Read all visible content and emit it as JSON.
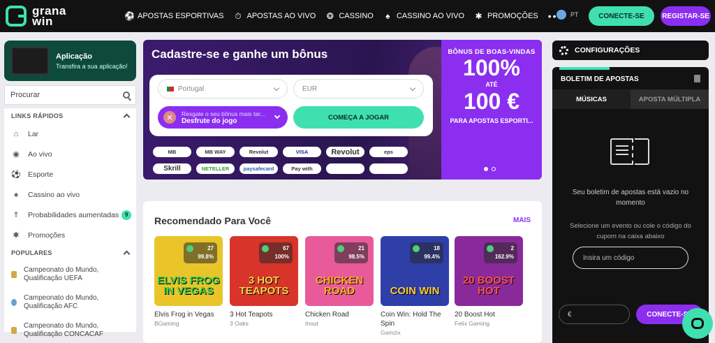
{
  "brand": {
    "line1": "grana",
    "line2": "win"
  },
  "nav": {
    "items": [
      {
        "label": "APOSTAS ESPORTIVAS",
        "icon": "soccer-ball-icon"
      },
      {
        "label": "APOSTAS AO VIVO",
        "icon": "stopwatch-icon"
      },
      {
        "label": "CASSINO",
        "icon": "roulette-icon"
      },
      {
        "label": "CASSINO AO VIVO",
        "icon": "cards-icon"
      },
      {
        "label": "PROMOÇÕES",
        "icon": "gift-icon"
      }
    ],
    "more": "•••",
    "lang": "PT",
    "login": "CONECTE-SE",
    "register": "REGISTAR-SE"
  },
  "sidebar": {
    "app": {
      "title": "Aplicação",
      "subtitle": "Transfira a sua aplicação!"
    },
    "search_placeholder": "Procurar",
    "quick_links_header": "LINKS RÁPIDOS",
    "quick_links": [
      {
        "label": "Lar",
        "icon": "home-icon"
      },
      {
        "label": "Ao vivo",
        "icon": "live-icon"
      },
      {
        "label": "Esporte",
        "icon": "soccer-ball-icon"
      },
      {
        "label": "Cassino ao vivo",
        "icon": "cards-icon"
      },
      {
        "label": "Probabilidades aumentadas",
        "icon": "boost-icon",
        "badge": "9"
      },
      {
        "label": "Promoções",
        "icon": "gift-icon"
      }
    ],
    "popular_header": "POPULARES",
    "popular": [
      {
        "label": "Campeonato do Mundo, Qualificação UEFA"
      },
      {
        "label": "Campeonato do Mundo, Qualificação AFC"
      },
      {
        "label": "Campeonato do Mundo, Qualificação CONCACAF"
      }
    ]
  },
  "banner": {
    "title": "Cadastre-se e ganhe um bônus",
    "country": "Portugal",
    "currency": "EUR",
    "bonus_hint": "Resgate o seu bônus mais tar...",
    "bonus_value": "Desfrute do jogo",
    "start": "COMEÇA A JOGAR",
    "payments_row1": [
      "MB",
      "MB WAY",
      "Revolut",
      "VISA",
      "Revolut",
      "eps"
    ],
    "payments_row2": [
      "Skrill",
      "NETELLER",
      "paysafecard",
      "Pay with",
      "",
      ""
    ],
    "promo_t1": "BÔNUS DE BOAS-VINDAS",
    "promo_big1": "100%",
    "promo_ate": "ATÉ",
    "promo_big2": "100 €",
    "promo_t2": "PARA APOSTAS ESPORTI..."
  },
  "recommended": {
    "title": "Recomendado Para Você",
    "more": "MAIS",
    "games": [
      {
        "name": "Elvis Frog in Vegas",
        "provider": "BGaming",
        "count": "27",
        "rtp": "99.8%",
        "art": "ELVIS FROG IN VEGAS",
        "color": "#e9c52a"
      },
      {
        "name": "3 Hot Teapots",
        "provider": "3 Oaks",
        "count": "67",
        "rtp": "100%",
        "art": "3 HOT TEAPOTS",
        "color": "#d8342a"
      },
      {
        "name": "Chicken Road",
        "provider": "Inout",
        "count": "21",
        "rtp": "98.5%",
        "art": "CHICKEN ROAD",
        "color": "#e85a9a"
      },
      {
        "name": "Coin Win: Hold The Spin",
        "provider": "Gamzix",
        "count": "18",
        "rtp": "99.4%",
        "art": "COIN WIN",
        "color": "#2f3fa8"
      },
      {
        "name": "20 Boost Hot",
        "provider": "Felix Gaming",
        "count": "2",
        "rtp": "162.9%",
        "art": "20 BOOST HOT",
        "color": "#8a2a9a"
      }
    ]
  },
  "right": {
    "config": "CONFIGURAÇÕES",
    "slip_title": "BOLETIM DE APOSTAS",
    "tab_single": "MÚSICAS",
    "tab_multi": "APOSTA MÚLTIPLA",
    "empty": "Seu boletim de apostas está vazio no momento",
    "select_event": "Selecione um evento ou cole o código do cupom na caixa abaixo",
    "code_placeholder": "Insira um código",
    "stake_symbol": "€",
    "login": "CONECTE-SE"
  },
  "colors": {
    "accent": "#3fe0b0",
    "brand_purple": "#8b2ef0",
    "dark": "#121212"
  }
}
